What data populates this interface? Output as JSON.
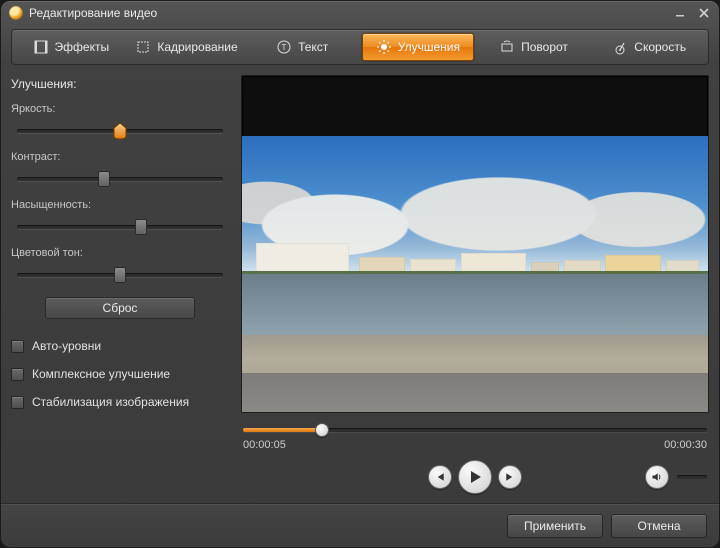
{
  "window": {
    "title": "Редактирование видео"
  },
  "tabs": {
    "effects": "Эффекты",
    "crop": "Кадрирование",
    "text": "Текст",
    "enhance": "Улучшения",
    "rotate": "Поворот",
    "speed": "Скорость"
  },
  "panel": {
    "heading": "Улучшения:",
    "brightness_label": "Яркость:",
    "brightness_pct": 50,
    "contrast_label": "Контраст:",
    "contrast_pct": 42,
    "saturation_label": "Насыщенность:",
    "saturation_pct": 60,
    "hue_label": "Цветовой тон:",
    "hue_pct": 50,
    "reset": "Сброс",
    "auto_levels": "Авто-уровни",
    "complex_enhance": "Комплексное улучшение",
    "stabilize": "Стабилизация изображения"
  },
  "player": {
    "position_pct": 17,
    "current_time": "00:00:05",
    "total_time": "00:00:30"
  },
  "footer": {
    "apply": "Применить",
    "cancel": "Отмена"
  }
}
